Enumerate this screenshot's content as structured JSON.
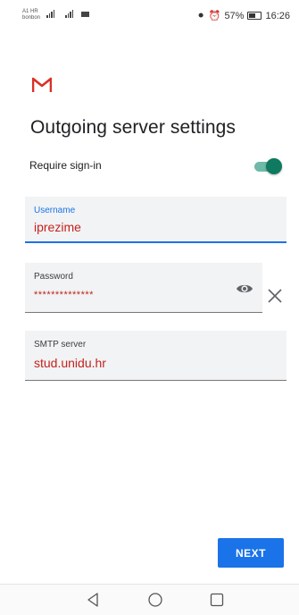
{
  "status_bar": {
    "carrier_line1": "A1 HR",
    "carrier_line2": "bonbon",
    "battery_percent": "57%",
    "time": "16:26"
  },
  "app": {
    "logo_icon": "gmail-m-icon"
  },
  "page": {
    "title": "Outgoing server settings"
  },
  "require_signin": {
    "label": "Require sign-in",
    "enabled": true
  },
  "fields": {
    "username": {
      "label": "Username",
      "value": "iprezime"
    },
    "password": {
      "label": "Password",
      "value": "**************"
    },
    "smtp": {
      "label": "SMTP server",
      "value": "stud.unidu.hr"
    }
  },
  "actions": {
    "next_label": "NEXT"
  },
  "colors": {
    "accent": "#1a73e8",
    "value_text": "#c5221f",
    "toggle": "#0e7a5f",
    "gmail_red": "#d93025"
  }
}
